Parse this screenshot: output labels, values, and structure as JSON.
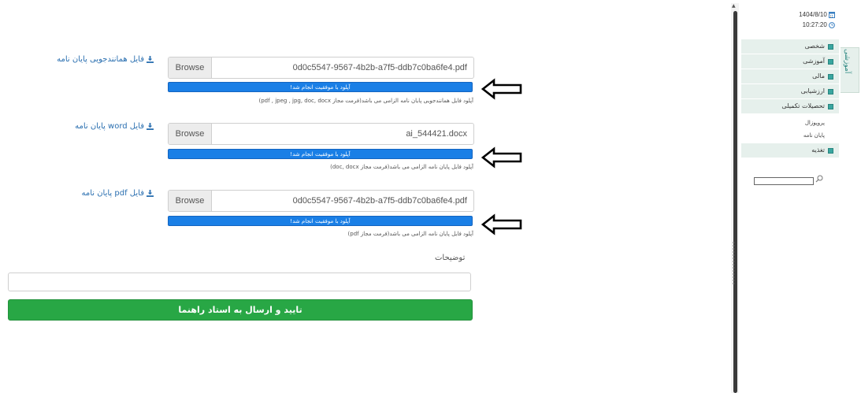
{
  "uploads": [
    {
      "link_label": "فایل همانندجویی پایان نامه",
      "browse_label": "Browse",
      "file_name": "0d0c5547-9567-4b2b-a7f5-ddb7c0ba6fe4.pdf",
      "progress_text": "آپلود با موفقیت انجام شد!",
      "progress": 1.0,
      "hint": "آپلود فایل همانندجویی پایان نامه الزامی می باشد(فرمت مجاز pdf , jpeg , jpg, doc, docx)"
    },
    {
      "link_label": "فایل word پایان نامه",
      "browse_label": "Browse",
      "file_name": "ai_544421.docx",
      "progress_text": "آپلود با موفقیت انجام شد!",
      "progress": 1.0,
      "hint": "آپلود فایل پایان نامه الزامی می باشد(فرمت مجاز doc, docx)"
    },
    {
      "link_label": "فایل pdf پایان نامه",
      "browse_label": "Browse",
      "file_name": "0d0c5547-9567-4b2b-a7f5-ddb7c0ba6fe4.pdf",
      "progress_text": "آپلود با موفقیت انجام شد!",
      "progress": 1.0,
      "hint": "آپلود فایل پایان نامه الزامی می باشد(فرمت مجاز pdf)"
    }
  ],
  "description": {
    "label": "توضیحات",
    "value": ""
  },
  "submit_label": "تایید و ارسال به استاد راهنما",
  "sidebar": {
    "date": "1404/8/10",
    "time": "10:27:20",
    "menu": [
      {
        "label": "شخصی"
      },
      {
        "label": "آموزشی"
      },
      {
        "label": "مالی"
      },
      {
        "label": "ارزشیابی"
      },
      {
        "label": "تحصیلات تکمیلی"
      }
    ],
    "submenu": [
      {
        "label": "پروپوزال"
      },
      {
        "label": "پایان نامه"
      }
    ],
    "menu_after": [
      {
        "label": "تغذیه"
      }
    ],
    "side_tab_label": "آموزشی",
    "search_value": ""
  },
  "colors": {
    "progress": "#1a7fe6",
    "submit": "#28a745",
    "menu_bg": "#e6f0ec",
    "menu_bullet": "#3aa6a0",
    "link": "#2a6fb0"
  },
  "icons": {
    "download": "download-icon",
    "arrow": "left-arrow-icon",
    "calendar": "calendar-icon",
    "clock": "clock-icon",
    "search": "search-icon"
  }
}
